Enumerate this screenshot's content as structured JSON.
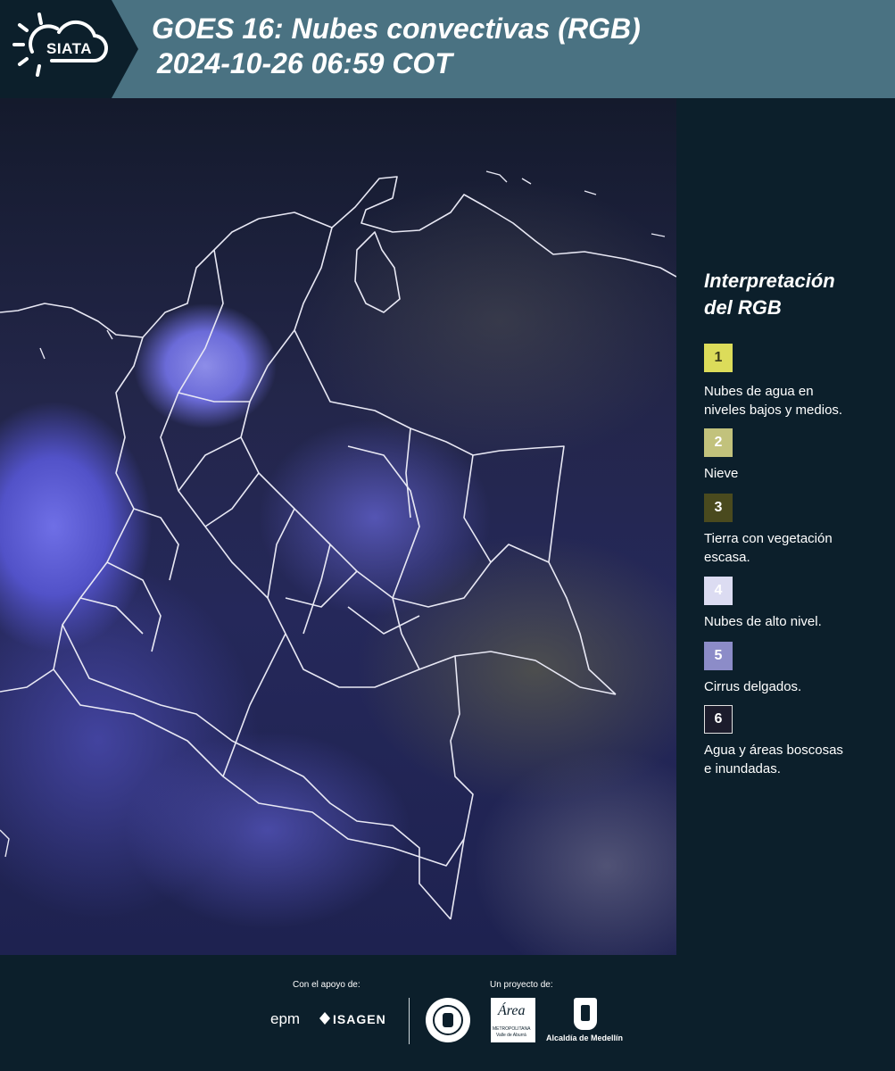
{
  "header": {
    "logo_text": "SIATA",
    "title_line1": "GOES 16: Nubes convectivas (RGB)",
    "title_line2": "2024-10-26 06:59 COT"
  },
  "map": {
    "description_icon": "satellite-rgb-map"
  },
  "legend": {
    "title_line1": "Interpretación",
    "title_line2": "del RGB",
    "items": [
      {
        "number": "1",
        "label_line1": "Nubes de agua en",
        "label_line2": "niveles bajos y medios.",
        "color": "#dcdc5a"
      },
      {
        "number": "2",
        "label_line1": "Nieve",
        "label_line2": "",
        "color": "#c2c27c"
      },
      {
        "number": "3",
        "label_line1": "Tierra con vegetación",
        "label_line2": "escasa.",
        "color": "#4a4a1e"
      },
      {
        "number": "4",
        "label_line1": "Nubes de alto nivel.",
        "label_line2": "",
        "color": "#dcdcf2"
      },
      {
        "number": "5",
        "label_line1": "Cirrus delgados.",
        "label_line2": "",
        "color": "#8c8cc8"
      },
      {
        "number": "6",
        "label_line1": "Agua y áreas boscosas",
        "label_line2": "e inundadas.",
        "color": "#1c1c2c"
      }
    ]
  },
  "footer": {
    "support_label": "Con el apoyo de:",
    "project_label": "Un proyecto de:",
    "epm": "epm",
    "isagen": "ISAGEN",
    "area_metro_name": "Área",
    "area_metro_sub1": "METROPOLITANA",
    "area_metro_sub2": "Valle de Aburrá",
    "alcaldia": "Alcaldía de Medellín"
  }
}
